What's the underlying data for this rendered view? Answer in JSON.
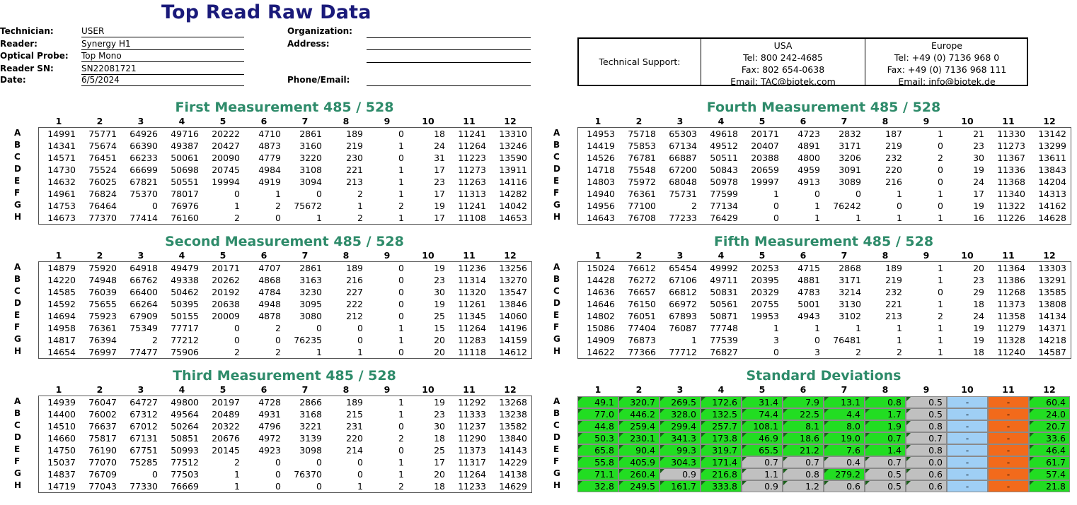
{
  "title": "Top Read Raw Data",
  "info": {
    "technician_label": "Technician:",
    "technician": "USER",
    "reader_label": "Reader:",
    "reader": "Synergy H1",
    "probe_label": "Optical Probe:",
    "probe": "Top Mono",
    "sn_label": "Reader SN:",
    "sn": "SN22081721",
    "date_label": "Date:",
    "date": "6/5/2024",
    "org_label": "Organization:",
    "address_label": "Address:",
    "phone_label": "Phone/Email:"
  },
  "support": {
    "label": "Technical Support:",
    "usa": {
      "region": "USA",
      "tel": "Tel: 800 242-4685",
      "fax": "Fax: 802 654-0638",
      "email": "Email: TAC@biotek.com"
    },
    "europe": {
      "region": "Europe",
      "tel": "Tel: +49 (0) 7136 968 0",
      "fax": "Fax: +49 (0) 7136 968 111",
      "email": "Email: info@biotek.de"
    }
  },
  "columns": [
    "1",
    "2",
    "3",
    "4",
    "5",
    "6",
    "7",
    "8",
    "9",
    "10",
    "11",
    "12"
  ],
  "rows": [
    "A",
    "B",
    "C",
    "D",
    "E",
    "F",
    "G",
    "H"
  ],
  "plates": [
    {
      "title": "First Measurement 485 / 528",
      "values": [
        [
          "14991",
          "75771",
          "64926",
          "49716",
          "20222",
          "4710",
          "2861",
          "189",
          "0",
          "18",
          "11241",
          "13310"
        ],
        [
          "14341",
          "75674",
          "66390",
          "49387",
          "20427",
          "4873",
          "3160",
          "219",
          "1",
          "24",
          "11264",
          "13246"
        ],
        [
          "14571",
          "76451",
          "66233",
          "50061",
          "20090",
          "4779",
          "3220",
          "230",
          "0",
          "31",
          "11223",
          "13590"
        ],
        [
          "14730",
          "75524",
          "66699",
          "50698",
          "20745",
          "4984",
          "3108",
          "221",
          "1",
          "17",
          "11273",
          "13911"
        ],
        [
          "14632",
          "76025",
          "67821",
          "50551",
          "19994",
          "4919",
          "3094",
          "213",
          "1",
          "23",
          "11263",
          "14116"
        ],
        [
          "14961",
          "76824",
          "75370",
          "78017",
          "0",
          "1",
          "0",
          "2",
          "1",
          "17",
          "11313",
          "14282"
        ],
        [
          "14753",
          "76464",
          "0",
          "76976",
          "1",
          "2",
          "75672",
          "1",
          "2",
          "19",
          "11241",
          "14042"
        ],
        [
          "14673",
          "77370",
          "77414",
          "76160",
          "2",
          "0",
          "1",
          "2",
          "1",
          "17",
          "11108",
          "14653"
        ]
      ]
    },
    {
      "title": "Second Measurement 485 / 528",
      "values": [
        [
          "14879",
          "75920",
          "64918",
          "49479",
          "20171",
          "4707",
          "2861",
          "189",
          "0",
          "19",
          "11236",
          "13256"
        ],
        [
          "14220",
          "74948",
          "66762",
          "49338",
          "20262",
          "4868",
          "3163",
          "216",
          "0",
          "23",
          "11314",
          "13270"
        ],
        [
          "14585",
          "76039",
          "66400",
          "50462",
          "20192",
          "4784",
          "3230",
          "227",
          "0",
          "30",
          "11320",
          "13547"
        ],
        [
          "14592",
          "75655",
          "66264",
          "50395",
          "20638",
          "4948",
          "3095",
          "222",
          "0",
          "19",
          "11261",
          "13846"
        ],
        [
          "14694",
          "75923",
          "67909",
          "50155",
          "20009",
          "4878",
          "3080",
          "212",
          "0",
          "25",
          "11345",
          "14060"
        ],
        [
          "14958",
          "76361",
          "75349",
          "77717",
          "0",
          "2",
          "0",
          "0",
          "1",
          "15",
          "11264",
          "14196"
        ],
        [
          "14817",
          "76394",
          "2",
          "77212",
          "0",
          "0",
          "76235",
          "0",
          "1",
          "20",
          "11283",
          "14159"
        ],
        [
          "14654",
          "76997",
          "77477",
          "75906",
          "2",
          "2",
          "1",
          "1",
          "0",
          "20",
          "11118",
          "14612"
        ]
      ]
    },
    {
      "title": "Third Measurement 485 / 528",
      "values": [
        [
          "14939",
          "76047",
          "64727",
          "49800",
          "20197",
          "4728",
          "2866",
          "189",
          "1",
          "19",
          "11292",
          "13268"
        ],
        [
          "14400",
          "76002",
          "67312",
          "49564",
          "20489",
          "4931",
          "3168",
          "215",
          "1",
          "23",
          "11333",
          "13238"
        ],
        [
          "14510",
          "76637",
          "67012",
          "50264",
          "20322",
          "4796",
          "3221",
          "231",
          "0",
          "30",
          "11237",
          "13582"
        ],
        [
          "14660",
          "75817",
          "67131",
          "50851",
          "20676",
          "4972",
          "3139",
          "220",
          "2",
          "18",
          "11290",
          "13840"
        ],
        [
          "14750",
          "76190",
          "67751",
          "50993",
          "20145",
          "4923",
          "3098",
          "214",
          "0",
          "25",
          "11373",
          "14143"
        ],
        [
          "15037",
          "77070",
          "75285",
          "77512",
          "2",
          "0",
          "0",
          "0",
          "1",
          "17",
          "11317",
          "14229"
        ],
        [
          "14837",
          "76709",
          "0",
          "77503",
          "1",
          "0",
          "76370",
          "0",
          "1",
          "20",
          "11264",
          "14138"
        ],
        [
          "14719",
          "77043",
          "77330",
          "76669",
          "1",
          "0",
          "0",
          "1",
          "2",
          "18",
          "11233",
          "14629"
        ]
      ]
    },
    {
      "title": "Fourth Measurement 485 / 528",
      "values": [
        [
          "14953",
          "75718",
          "65303",
          "49618",
          "20171",
          "4723",
          "2832",
          "187",
          "1",
          "21",
          "11330",
          "13142"
        ],
        [
          "14419",
          "75853",
          "67134",
          "49512",
          "20407",
          "4891",
          "3171",
          "219",
          "0",
          "23",
          "11273",
          "13299"
        ],
        [
          "14526",
          "76781",
          "66887",
          "50511",
          "20388",
          "4800",
          "3206",
          "232",
          "2",
          "30",
          "11367",
          "13611"
        ],
        [
          "14718",
          "75548",
          "67200",
          "50843",
          "20659",
          "4959",
          "3091",
          "220",
          "0",
          "19",
          "11336",
          "13843"
        ],
        [
          "14803",
          "75972",
          "68048",
          "50978",
          "19997",
          "4913",
          "3089",
          "216",
          "0",
          "24",
          "11368",
          "14204"
        ],
        [
          "14940",
          "76361",
          "75731",
          "77599",
          "1",
          "0",
          "0",
          "1",
          "1",
          "17",
          "11340",
          "14313"
        ],
        [
          "14956",
          "77100",
          "2",
          "77134",
          "0",
          "1",
          "76242",
          "0",
          "0",
          "19",
          "11322",
          "14162"
        ],
        [
          "14643",
          "76708",
          "77233",
          "76429",
          "0",
          "1",
          "1",
          "1",
          "1",
          "16",
          "11226",
          "14628"
        ]
      ]
    },
    {
      "title": "Fifth Measurement 485 / 528",
      "values": [
        [
          "15024",
          "76612",
          "65454",
          "49992",
          "20253",
          "4715",
          "2868",
          "189",
          "1",
          "20",
          "11364",
          "13303"
        ],
        [
          "14428",
          "76272",
          "67106",
          "49711",
          "20395",
          "4881",
          "3171",
          "219",
          "1",
          "23",
          "11386",
          "13291"
        ],
        [
          "14636",
          "76657",
          "66812",
          "50831",
          "20329",
          "4783",
          "3214",
          "232",
          "0",
          "29",
          "11268",
          "13585"
        ],
        [
          "14646",
          "76150",
          "66972",
          "50561",
          "20755",
          "5001",
          "3130",
          "221",
          "1",
          "18",
          "11373",
          "13808"
        ],
        [
          "14802",
          "76051",
          "67893",
          "50871",
          "19953",
          "4943",
          "3102",
          "213",
          "2",
          "24",
          "11358",
          "14134"
        ],
        [
          "15086",
          "77404",
          "76087",
          "77748",
          "1",
          "1",
          "1",
          "1",
          "1",
          "19",
          "11279",
          "14371"
        ],
        [
          "14909",
          "76873",
          "1",
          "77539",
          "3",
          "0",
          "76481",
          "1",
          "1",
          "19",
          "11328",
          "14218"
        ],
        [
          "14622",
          "77366",
          "77712",
          "76827",
          "0",
          "3",
          "2",
          "2",
          "1",
          "18",
          "11240",
          "14587"
        ]
      ]
    }
  ],
  "std_dev": {
    "title": "Standard Deviations",
    "colors": {
      "green": "#22dd22",
      "gray": "#c0c0c0",
      "blue": "#9fcff5",
      "orange": "#f26a1b"
    },
    "values": [
      [
        "49.1",
        "320.7",
        "269.5",
        "172.6",
        "31.4",
        "7.9",
        "13.1",
        "0.8",
        "0.5",
        "-",
        "-",
        "60.4"
      ],
      [
        "77.0",
        "446.2",
        "328.0",
        "132.5",
        "74.4",
        "22.5",
        "4.4",
        "1.7",
        "0.5",
        "-",
        "-",
        "24.0"
      ],
      [
        "44.8",
        "259.4",
        "299.4",
        "257.7",
        "108.1",
        "8.1",
        "8.0",
        "1.9",
        "0.8",
        "-",
        "-",
        "20.7"
      ],
      [
        "50.3",
        "230.1",
        "341.3",
        "173.8",
        "46.9",
        "18.6",
        "19.0",
        "0.7",
        "0.7",
        "-",
        "-",
        "33.6"
      ],
      [
        "65.8",
        "90.4",
        "99.3",
        "319.7",
        "65.5",
        "21.2",
        "7.6",
        "1.4",
        "0.8",
        "-",
        "-",
        "46.4"
      ],
      [
        "55.8",
        "405.9",
        "304.3",
        "171.4",
        "0.7",
        "0.7",
        "0.4",
        "0.7",
        "0.0",
        "-",
        "-",
        "61.7"
      ],
      [
        "71.1",
        "260.4",
        "0.9",
        "216.8",
        "1.1",
        "0.8",
        "279.2",
        "0.5",
        "0.6",
        "-",
        "-",
        "57.4"
      ],
      [
        "32.8",
        "249.5",
        "161.7",
        "333.8",
        "0.9",
        "1.2",
        "0.6",
        "0.5",
        "0.6",
        "-",
        "-",
        "21.8"
      ]
    ],
    "fills": [
      [
        "green",
        "green",
        "green",
        "green",
        "green",
        "green",
        "green",
        "green",
        "gray",
        "blue",
        "orange",
        "green"
      ],
      [
        "green",
        "green",
        "green",
        "green",
        "green",
        "green",
        "green",
        "green",
        "gray",
        "blue",
        "orange",
        "green"
      ],
      [
        "green",
        "green",
        "green",
        "green",
        "green",
        "green",
        "green",
        "green",
        "gray",
        "blue",
        "orange",
        "green"
      ],
      [
        "green",
        "green",
        "green",
        "green",
        "green",
        "green",
        "green",
        "green",
        "gray",
        "blue",
        "orange",
        "green"
      ],
      [
        "green",
        "green",
        "green",
        "green",
        "green",
        "green",
        "green",
        "green",
        "gray",
        "blue",
        "orange",
        "green"
      ],
      [
        "green",
        "green",
        "green",
        "green",
        "gray",
        "gray",
        "gray",
        "gray",
        "gray",
        "blue",
        "orange",
        "green"
      ],
      [
        "green",
        "green",
        "gray",
        "green",
        "gray",
        "gray",
        "green",
        "gray",
        "gray",
        "blue",
        "orange",
        "green"
      ],
      [
        "green",
        "green",
        "green",
        "green",
        "gray",
        "gray",
        "gray",
        "gray",
        "gray",
        "blue",
        "orange",
        "green"
      ]
    ]
  }
}
